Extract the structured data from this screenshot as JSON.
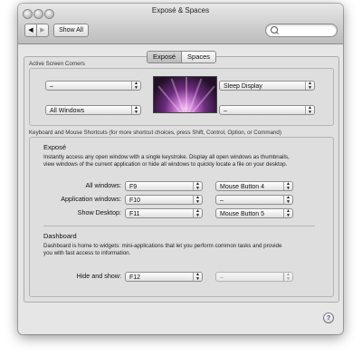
{
  "window": {
    "title": "Exposé & Spaces"
  },
  "toolbar": {
    "back": "◀",
    "forward": "▶",
    "show_all": "Show All",
    "search_placeholder": ""
  },
  "tabs": {
    "expose": "Exposé",
    "spaces": "Spaces"
  },
  "corners": {
    "label": "Active Screen Corners",
    "top_left": "–",
    "top_right": "Sleep Display",
    "bottom_left": "All Windows",
    "bottom_right": "–"
  },
  "shortcuts": {
    "label": "Keyboard and Mouse Shortcuts (for more shortcut choices, press Shift, Control, Option, or Command)"
  },
  "expose": {
    "title": "Exposé",
    "description_line1": "Instantly access any open window with a single keystroke. Display all open windows as thumbnails,",
    "description_line2": "view windows of the current application or hide all windows to quickly locate a file on your desktop.",
    "rows": [
      {
        "label": "All windows:",
        "key": "F9",
        "mouse": "Mouse Button 4"
      },
      {
        "label": "Application windows:",
        "key": "F10",
        "mouse": "–"
      },
      {
        "label": "Show Desktop:",
        "key": "F11",
        "mouse": "Mouse Button 5"
      }
    ]
  },
  "dashboard": {
    "title": "Dashboard",
    "description_line1": "Dashboard is home to widgets: mini-applications that let you perform common tasks and provide",
    "description_line2": "you with fast access to information.",
    "hide_show_label": "Hide and show:",
    "key": "F12",
    "mouse": "–"
  },
  "help": {
    "label": "?"
  }
}
